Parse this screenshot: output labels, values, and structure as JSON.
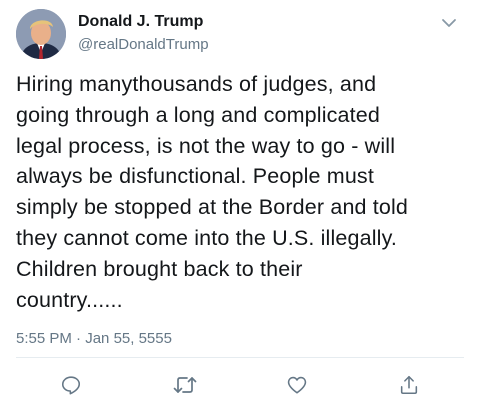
{
  "tweet": {
    "author_name": "Donald J. Trump",
    "author_handle": "@realDonaldTrump",
    "text": "Hiring manythousands of judges, and\ngoing through a long and complicated\nlegal process, is not the way to go - will\nalways be disfunctional. People must\nsimply be stopped at the Border and told\nthey cannot come into the U.S. illegally.\nChildren brought back to their\ncountry......",
    "time": "5:55 PM",
    "separator": "·",
    "date": "Jan 55, 5555"
  },
  "icons": {
    "menu": "chevron-down-icon",
    "reply": "reply-icon",
    "retweet": "retweet-icon",
    "like": "heart-icon",
    "share": "share-icon"
  },
  "colors": {
    "text": "#14171a",
    "secondary": "#657786",
    "divider": "#e6ecf0"
  }
}
